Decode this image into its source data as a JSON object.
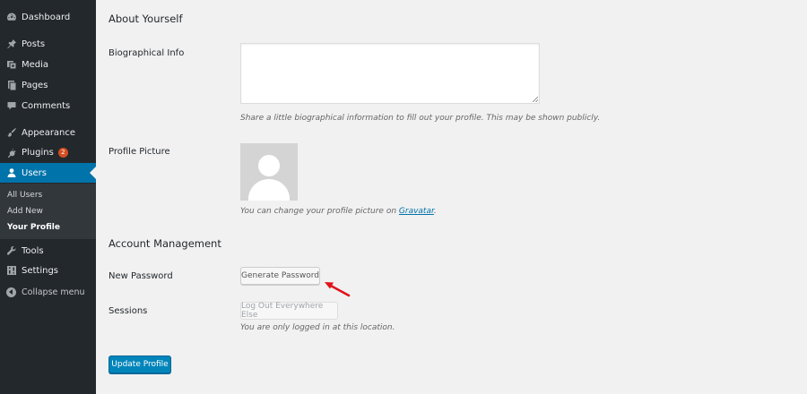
{
  "sidebar": {
    "items": [
      {
        "label": "Dashboard",
        "icon": "dashboard-icon"
      },
      {
        "label": "Posts",
        "icon": "pin-icon"
      },
      {
        "label": "Media",
        "icon": "media-icon"
      },
      {
        "label": "Pages",
        "icon": "pages-icon"
      },
      {
        "label": "Comments",
        "icon": "comment-icon"
      },
      {
        "label": "Appearance",
        "icon": "brush-icon"
      },
      {
        "label": "Plugins",
        "icon": "plugin-icon",
        "badge": "2"
      },
      {
        "label": "Users",
        "icon": "user-icon",
        "active": true
      },
      {
        "label": "Tools",
        "icon": "wrench-icon"
      },
      {
        "label": "Settings",
        "icon": "settings-icon"
      }
    ],
    "submenu": [
      {
        "label": "All Users"
      },
      {
        "label": "Add New"
      },
      {
        "label": "Your Profile",
        "current": true
      }
    ],
    "collapse_label": "Collapse menu"
  },
  "about": {
    "heading": "About Yourself",
    "bio_label": "Biographical Info",
    "bio_value": "",
    "bio_description": "Share a little biographical information to fill out your profile. This may be shown publicly.",
    "picture_label": "Profile Picture",
    "picture_description_prefix": "You can change your profile picture on ",
    "picture_link": "Gravatar",
    "picture_description_suffix": "."
  },
  "account": {
    "heading": "Account Management",
    "password_label": "New Password",
    "generate_button": "Generate Password",
    "sessions_label": "Sessions",
    "logout_button": "Log Out Everywhere Else",
    "sessions_description": "You are only logged in at this location."
  },
  "update_button": "Update Profile",
  "colors": {
    "sidebar_bg": "#23282d",
    "active_bg": "#0073aa",
    "primary_button": "#0085ba",
    "badge": "#d54e21",
    "annotation_arrow": "#e0131b"
  }
}
